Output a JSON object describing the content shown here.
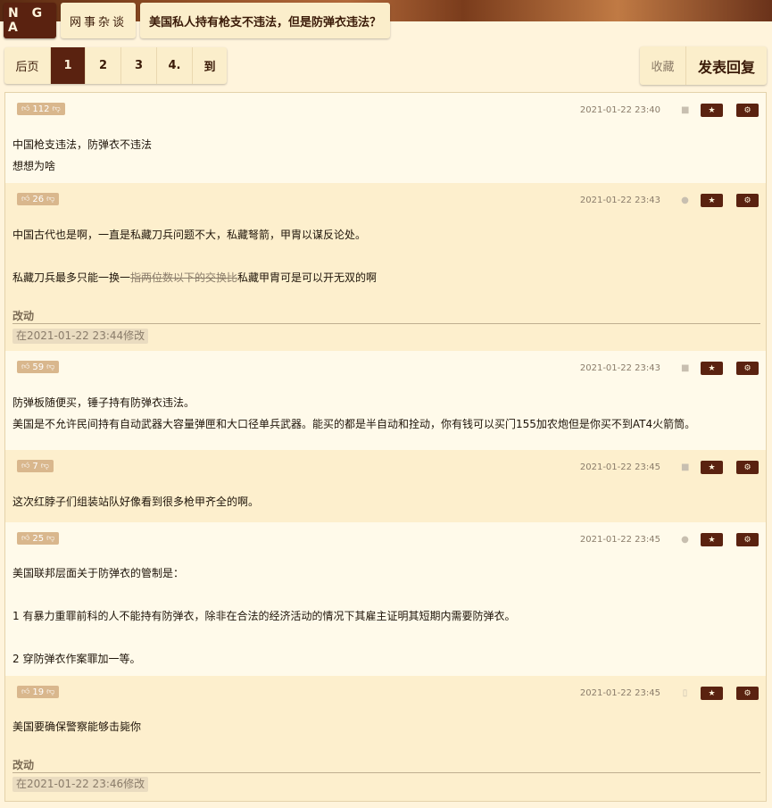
{
  "header": {
    "logo": "N G A",
    "forum": "网事杂谈",
    "thread_title": "美国私人持有枪支不违法，但是防弹衣违法？"
  },
  "pager": {
    "back": "后页",
    "pages": [
      "1",
      "2",
      "3",
      "4."
    ],
    "current": "1",
    "goto": "到"
  },
  "actions": {
    "favorite": "收藏",
    "reply": "发表回复"
  },
  "icons": {
    "thumb_up": "thumbs-up-icon",
    "thumb_down": "thumbs-down-icon",
    "favorite": "star-icon",
    "settings": "gear-icon",
    "device_android": "android-icon",
    "device_apple": "apple-icon",
    "device_phone": "phone-icon"
  },
  "colors": {
    "accent": "#5a2210",
    "post_light": "#fffaea",
    "post_dark": "#fdefcd"
  },
  "posts": [
    {
      "votes": "112",
      "time": "2021-01-22 23:40",
      "device": "android-icon",
      "lines": [
        "中国枪支违法，防弹衣不违法",
        "想想为啥"
      ]
    },
    {
      "votes": "26",
      "time": "2021-01-22 23:43",
      "device": "apple-icon",
      "line1": "中国古代也是啊，一直是私藏刀兵问题不大，私藏弩箭，甲胄以谋反论处。",
      "line2_pre": "私藏刀兵最多只能一换一",
      "line2_strike": "指两位数以下的交换比",
      "line2_post": "私藏甲胄可是可以开无双的啊",
      "edit_title": "改动",
      "edit_time": "在2021-01-22 23:44修改"
    },
    {
      "votes": "59",
      "time": "2021-01-22 23:43",
      "device": "android-icon",
      "lines": [
        "防弹板随便买，锤子持有防弹衣违法。",
        "美国是不允许民间持有自动武器大容量弹匣和大口径单兵武器。能买的都是半自动和拴动，你有钱可以买门155加农炮但是你买不到AT4火箭筒。"
      ]
    },
    {
      "votes": "7",
      "time": "2021-01-22 23:45",
      "device": "android-icon",
      "lines": [
        "这次红脖子们组装站队好像看到很多枪甲齐全的啊。"
      ]
    },
    {
      "votes": "25",
      "time": "2021-01-22 23:45",
      "device": "apple-icon",
      "lines": [
        "美国联邦层面关于防弹衣的管制是：",
        "1 有暴力重罪前科的人不能持有防弹衣，除非在合法的经济活动的情况下其雇主证明其短期内需要防弹衣。",
        "2 穿防弹衣作案罪加一等。"
      ]
    },
    {
      "votes": "19",
      "time": "2021-01-22 23:45",
      "device": "phone-icon",
      "lines": [
        "美国要确保警察能够击毙你"
      ],
      "edit_title": "改动",
      "edit_time": "在2021-01-22 23:46修改"
    }
  ]
}
